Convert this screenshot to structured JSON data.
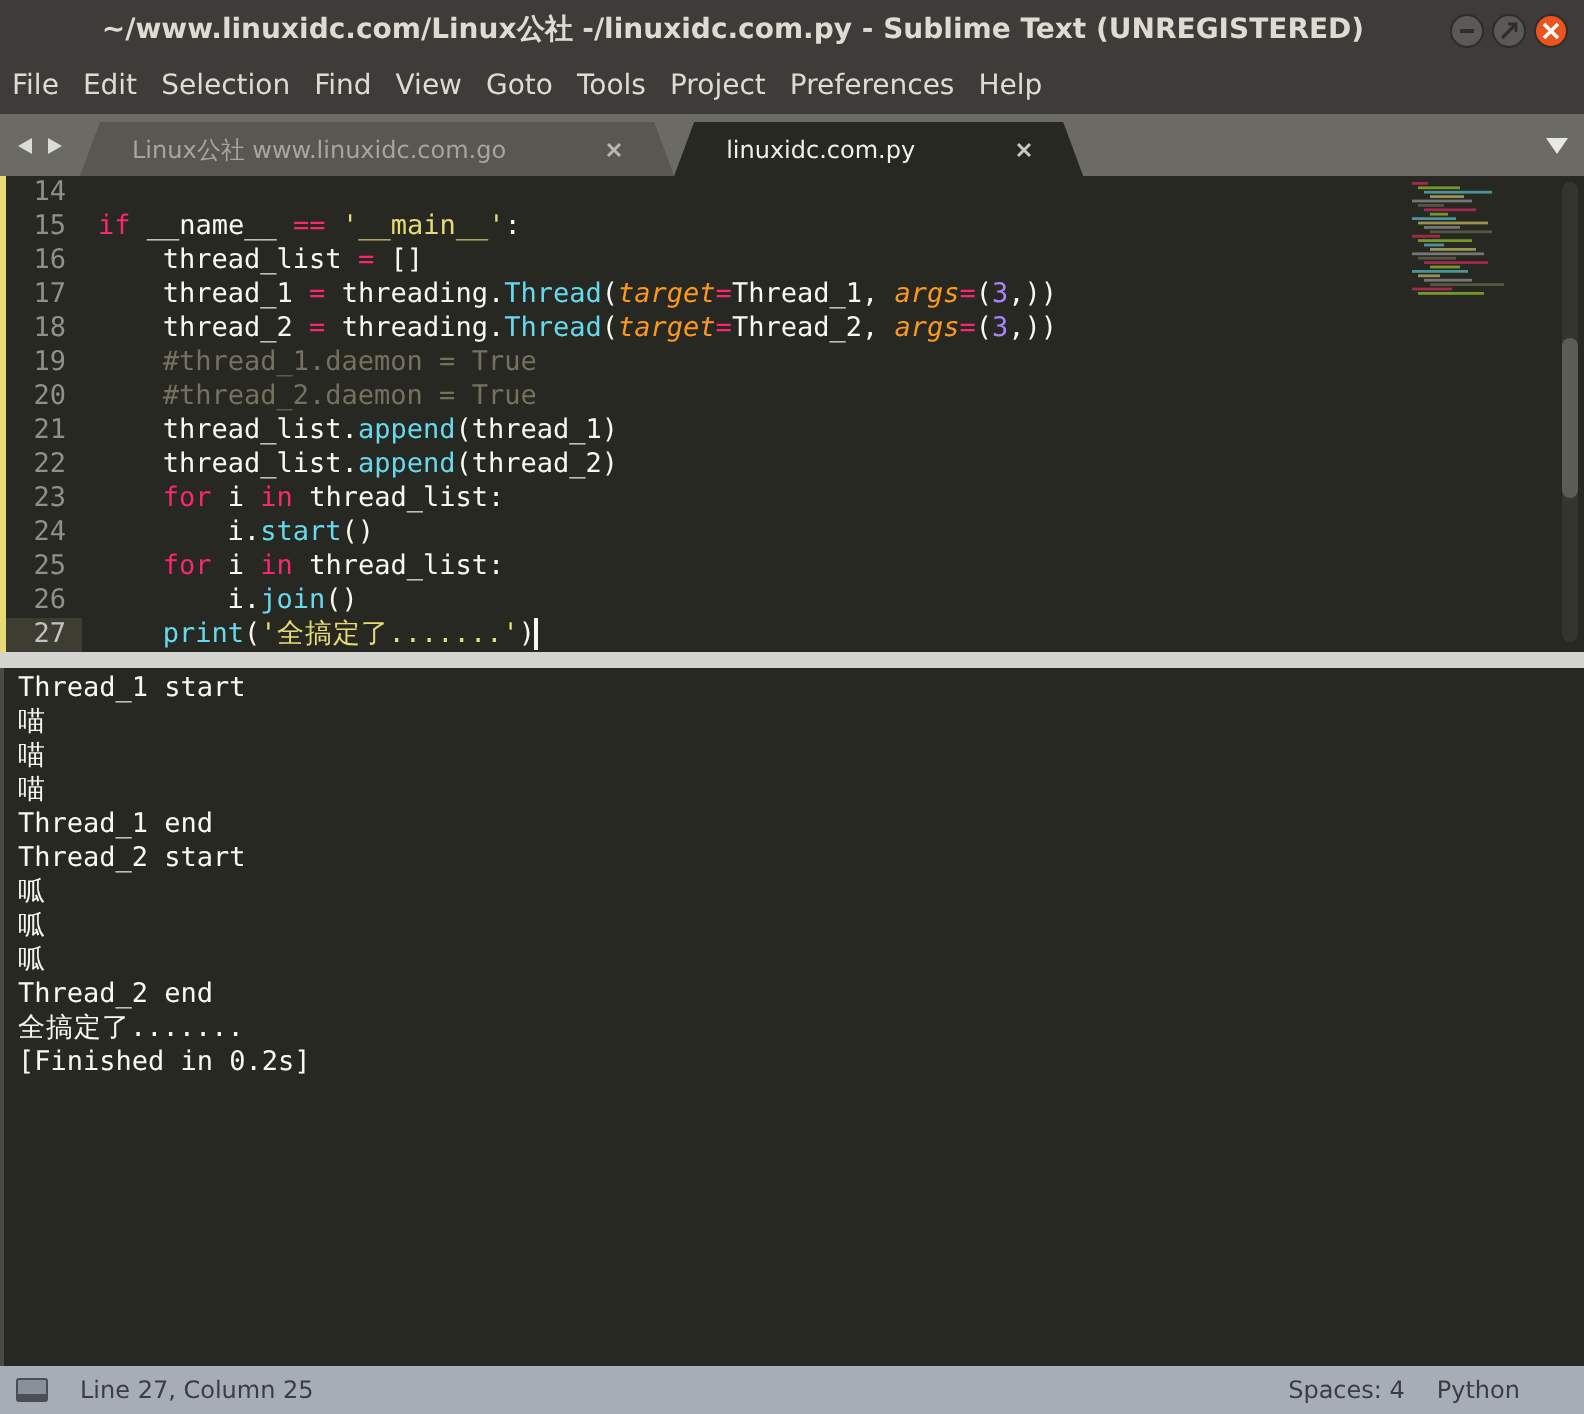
{
  "window": {
    "title": "~/www.linuxidc.com/Linux公社 -/linuxidc.com.py - Sublime Text (UNREGISTERED)"
  },
  "menu": [
    "File",
    "Edit",
    "Selection",
    "Find",
    "View",
    "Goto",
    "Tools",
    "Project",
    "Preferences",
    "Help"
  ],
  "tabs": [
    {
      "label": "Linux公社 www.linuxidc.com.go",
      "selected": false
    },
    {
      "label": "linuxidc.com.py",
      "selected": true
    }
  ],
  "editor": {
    "lines": [
      {
        "number": "14",
        "current": false
      },
      {
        "number": "15",
        "current": false,
        "tokens": [
          {
            "kind": "keyword",
            "text": "if"
          },
          {
            "kind": "plain",
            "text": " __name__ "
          },
          {
            "kind": "operator",
            "text": "== "
          },
          {
            "kind": "string",
            "text": "'__main__'"
          },
          {
            "kind": "plain",
            "text": ":"
          }
        ],
        "children": [
          {
            "number": "16",
            "current": false,
            "tokens": [
              {
                "kind": "plain",
                "text": "thread_list "
              },
              {
                "kind": "operator",
                "text": "="
              },
              {
                "kind": "plain",
                "text": " []"
              }
            ]
          },
          {
            "number": "17",
            "current": false,
            "tokens": [
              {
                "kind": "plain",
                "text": "thread_1 "
              },
              {
                "kind": "operator",
                "text": "="
              },
              {
                "kind": "plain",
                "text": " threading."
              },
              {
                "kind": "func",
                "text": "Thread"
              },
              {
                "kind": "plain",
                "text": "("
              },
              {
                "kind": "param",
                "text": "target"
              },
              {
                "kind": "operator",
                "text": "="
              },
              {
                "kind": "plain",
                "text": "Thread_1, "
              },
              {
                "kind": "param",
                "text": "args"
              },
              {
                "kind": "operator",
                "text": "="
              },
              {
                "kind": "plain",
                "text": "("
              },
              {
                "kind": "number",
                "text": "3"
              },
              {
                "kind": "plain",
                "text": ",))"
              }
            ]
          },
          {
            "number": "18",
            "current": false,
            "tokens": [
              {
                "kind": "plain",
                "text": "thread_2 "
              },
              {
                "kind": "operator",
                "text": "="
              },
              {
                "kind": "plain",
                "text": " threading."
              },
              {
                "kind": "func",
                "text": "Thread"
              },
              {
                "kind": "plain",
                "text": "("
              },
              {
                "kind": "param",
                "text": "target"
              },
              {
                "kind": "operator",
                "text": "="
              },
              {
                "kind": "plain",
                "text": "Thread_2, "
              },
              {
                "kind": "param",
                "text": "args"
              },
              {
                "kind": "operator",
                "text": "="
              },
              {
                "kind": "plain",
                "text": "("
              },
              {
                "kind": "number",
                "text": "3"
              },
              {
                "kind": "plain",
                "text": ",))"
              }
            ]
          },
          {
            "number": "19",
            "current": false,
            "tokens": [
              {
                "kind": "comment",
                "text": "#thread_1.daemon = True"
              }
            ]
          },
          {
            "number": "20",
            "current": false,
            "tokens": [
              {
                "kind": "comment",
                "text": "#thread_2.daemon = True"
              }
            ]
          },
          {
            "number": "21",
            "current": false,
            "tokens": [
              {
                "kind": "plain",
                "text": "thread_list."
              },
              {
                "kind": "func",
                "text": "append"
              },
              {
                "kind": "plain",
                "text": "(thread_1)"
              }
            ]
          },
          {
            "number": "22",
            "current": false,
            "tokens": [
              {
                "kind": "plain",
                "text": "thread_list."
              },
              {
                "kind": "func",
                "text": "append"
              },
              {
                "kind": "plain",
                "text": "(thread_2)"
              }
            ]
          },
          {
            "number": "23",
            "current": false,
            "tokens": [
              {
                "kind": "keyword",
                "text": "for"
              },
              {
                "kind": "plain",
                "text": " i "
              },
              {
                "kind": "keyword",
                "text": "in"
              },
              {
                "kind": "plain",
                "text": " thread_list:"
              }
            ],
            "children": [
              {
                "number": "24",
                "current": false,
                "tokens": [
                  {
                    "kind": "plain",
                    "text": "i."
                  },
                  {
                    "kind": "func",
                    "text": "start"
                  },
                  {
                    "kind": "plain",
                    "text": "()"
                  }
                ]
              }
            ]
          },
          {
            "number": "25",
            "current": false,
            "tokens": [
              {
                "kind": "keyword",
                "text": "for"
              },
              {
                "kind": "plain",
                "text": " i "
              },
              {
                "kind": "keyword",
                "text": "in"
              },
              {
                "kind": "plain",
                "text": " thread_list:"
              }
            ],
            "children": [
              {
                "number": "26",
                "current": false,
                "tokens": [
                  {
                    "kind": "plain",
                    "text": "i."
                  },
                  {
                    "kind": "func",
                    "text": "join"
                  },
                  {
                    "kind": "plain",
                    "text": "()"
                  }
                ]
              }
            ]
          },
          {
            "number": "27",
            "current": true,
            "tokens": [
              {
                "kind": "func",
                "text": "print"
              },
              {
                "kind": "plain",
                "text": "("
              },
              {
                "kind": "string",
                "text": "'全搞定了.......'"
              },
              {
                "kind": "plain",
                "text": ")"
              }
            ]
          }
        ]
      }
    ]
  },
  "output": [
    "Thread_1 start",
    "喵",
    "喵",
    "喵",
    "Thread_1 end",
    "Thread_2 start",
    "呱",
    "呱",
    "呱",
    "Thread_2 end",
    "全搞定了.......",
    "[Finished in 0.2s]"
  ],
  "status_bar": {
    "position": "Line 27, Column 25",
    "indentation": "Spaces: 4",
    "syntax": "Python"
  }
}
